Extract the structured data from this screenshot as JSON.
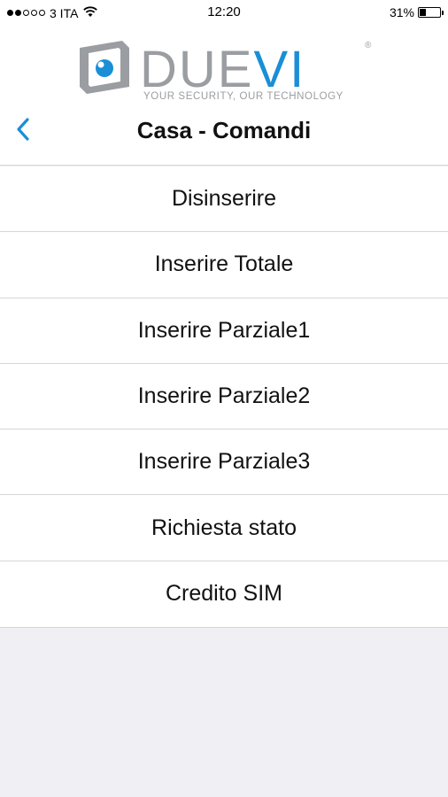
{
  "status_bar": {
    "carrier": "3 ITA",
    "time": "12:20",
    "battery_percent": "31%",
    "battery_level": 0.31,
    "signal_bars": 2,
    "signal_total": 5
  },
  "header": {
    "logo_wordmark": "DUEVI",
    "logo_tagline": "YOUR SECURITY, OUR TECHNOLOGY",
    "logo_registered": "®",
    "title": "Casa - Comandi",
    "back_icon": "chevron-left-icon",
    "accent_color": "#1a8fd6",
    "logo_gray": "#9a9da1"
  },
  "commands": [
    {
      "label": "Disinserire"
    },
    {
      "label": "Inserire Totale"
    },
    {
      "label": "Inserire Parziale1"
    },
    {
      "label": "Inserire Parziale2"
    },
    {
      "label": "Inserire Parziale3"
    },
    {
      "label": "Richiesta stato"
    },
    {
      "label": "Credito SIM"
    }
  ]
}
